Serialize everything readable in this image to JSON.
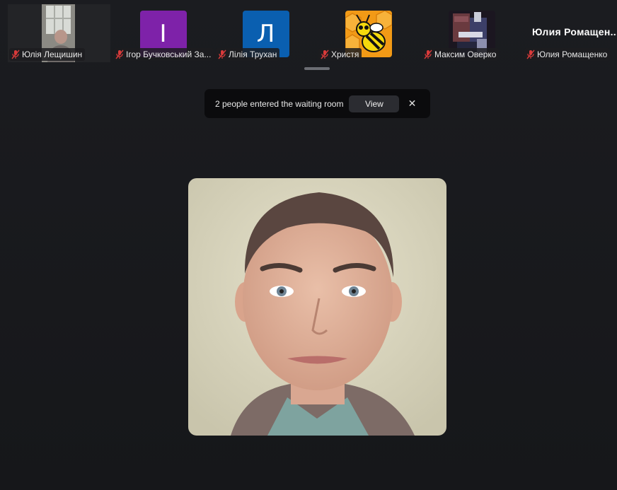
{
  "participants": [
    {
      "name": "Юлія Лещишин"
    },
    {
      "name": "Ігор Бучковський За...",
      "initial": "І",
      "color": "#7e22a9"
    },
    {
      "name": "Лілія Трухан",
      "initial": "Л",
      "color": "#0a5fb0"
    },
    {
      "name": "Христя"
    },
    {
      "name": "Максим Оверко"
    },
    {
      "name": "Юлия Ромащенко",
      "display_title": "Юлия  Ромащен..."
    }
  ],
  "waiting_room": {
    "message": "2 people entered the waiting room",
    "view_label": "View",
    "close_label": "✕"
  },
  "main_speaker": {}
}
